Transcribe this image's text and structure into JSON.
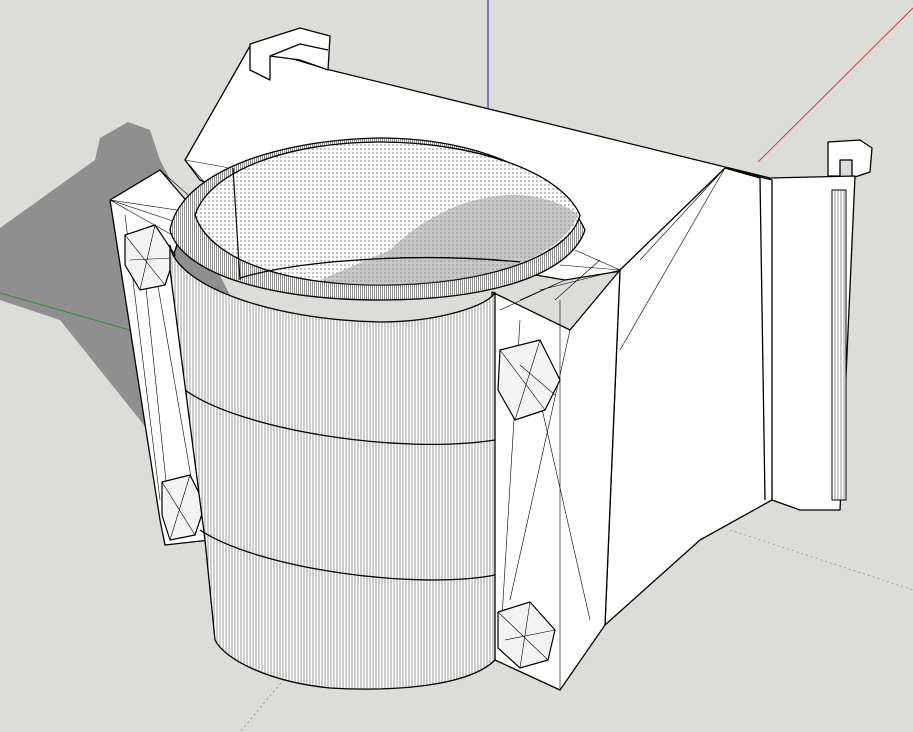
{
  "viewport": {
    "background_color": "#dcdcd8",
    "shadow_color": "#8f8f8f",
    "model_face_color": "#ffffff",
    "edge_color": "#000000"
  },
  "axes": {
    "blue_axis_color": "#1a1aa8",
    "red_axis_color": "#d23a3a",
    "green_axis_color": "#2f8f2f"
  }
}
